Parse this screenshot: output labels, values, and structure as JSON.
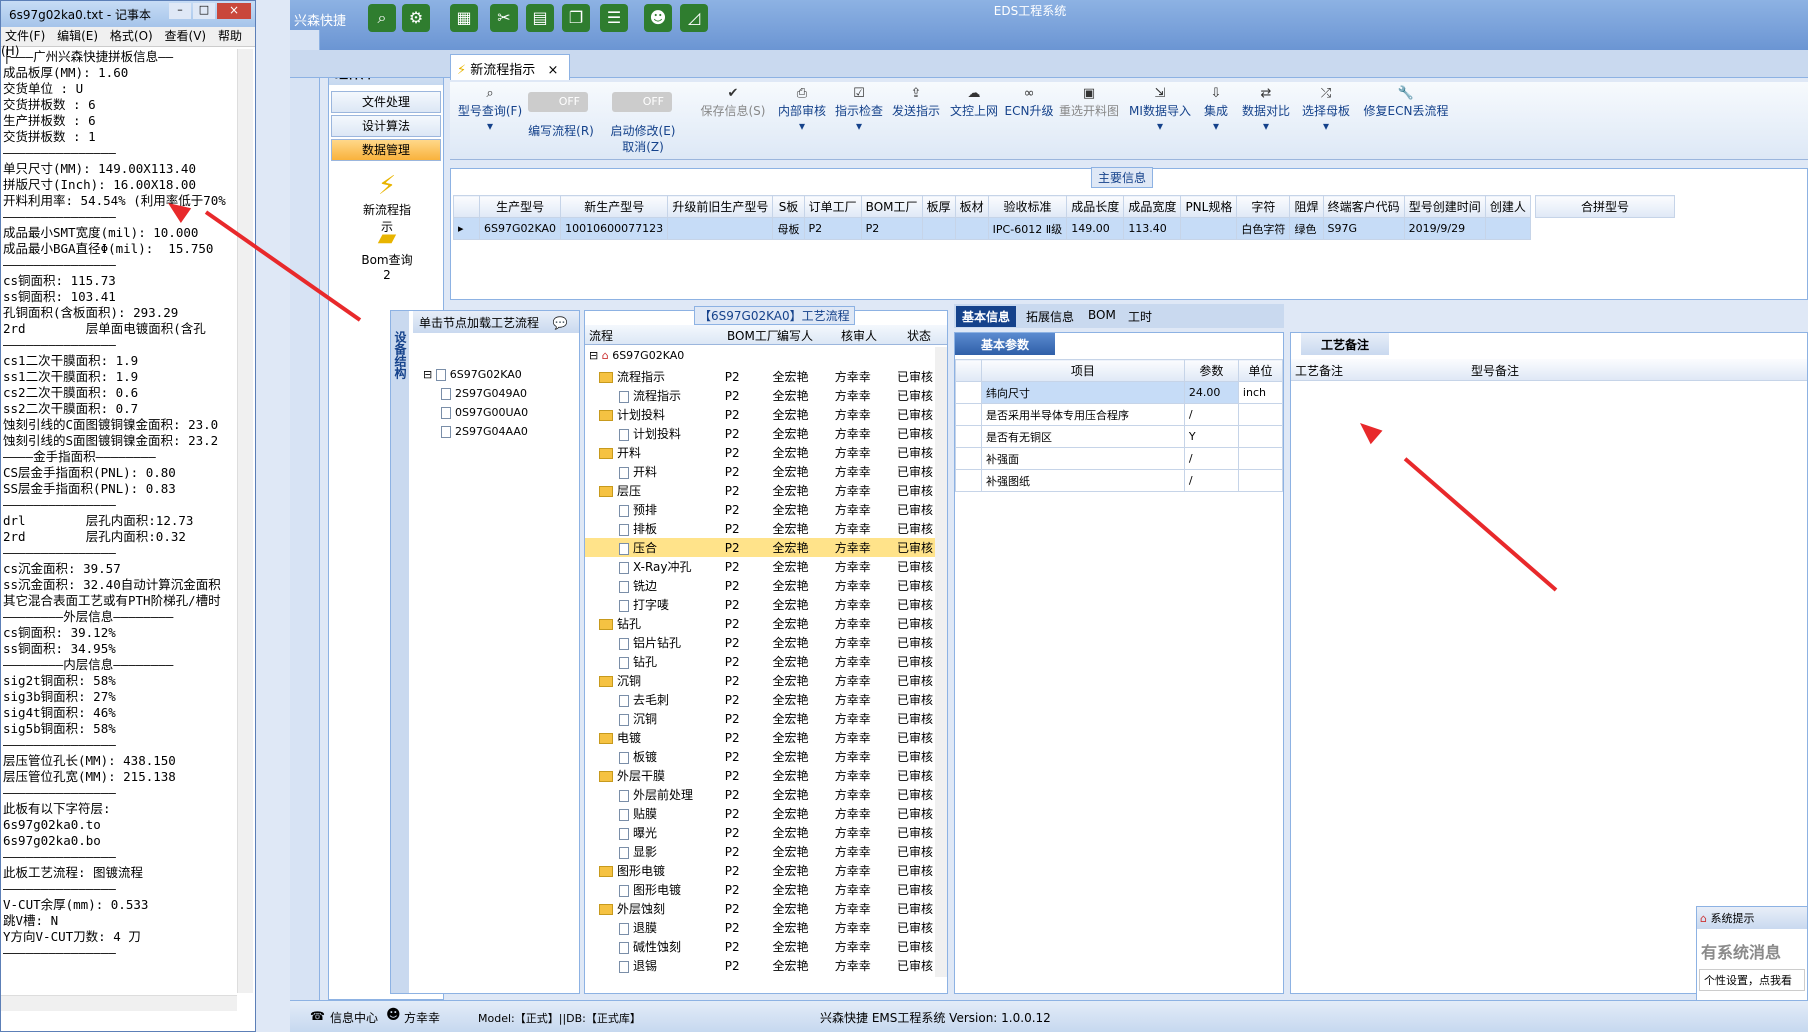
{
  "notepad": {
    "title": "6s97g02ka0.txt - 记事本",
    "menu": [
      "文件(F)",
      "编辑(E)",
      "格式(O)",
      "查看(V)",
      "帮助(H)"
    ],
    "lines": [
      "├———广州兴森快捷拼板信息——",
      "成品板厚(MM): 1.60",
      "交货单位 : U",
      "交货拼板数 : 6",
      "生产拼板数 : 6",
      "交货拼板数 : 1",
      "———————————————",
      "单只尺寸(MM): 149.00X113.40",
      "拼版尺寸(Inch): 16.00X18.00",
      "开料利用率: 54.54% (利用率低于70%",
      "———————————————",
      "成品最小SMT宽度(mil): 10.000",
      "成品最小BGA直径Φ(mil):  15.750",
      "———————————————",
      "cs铜面积: 115.73",
      "ss铜面积: 103.41",
      "孔铜面积(含板面积): 293.29",
      "2rd        层单面电镀面积(含孔",
      "———————————————",
      "cs1二次干膜面积: 1.9",
      "ss1二次干膜面积: 1.9",
      "cs2二次干膜面积: 0.6",
      "ss2二次干膜面积: 0.7",
      "蚀刻引线的C面图镀铜镍金面积: 23.0",
      "蚀刻引线的S面图镀铜镍金面积: 23.2",
      "————金手指面积————————",
      "CS层金手指面积(PNL): 0.80",
      "SS层金手指面积(PNL): 0.83",
      "———————————————",
      "drl        层孔内面积:12.73",
      "2rd        层孔内面积:0.32",
      "———————————————",
      "",
      "cs沉金面积: 39.57",
      "ss沉金面积: 32.40自动计算沉金面积",
      "其它混合表面工艺或有PTH阶梯孔/槽时",
      "————————外层信息————————",
      "cs铜面积: 39.12%",
      "ss铜面积: 34.95%",
      "————————内层信息————————",
      "sig2t铜面积: 58%",
      "sig3b铜面积: 27%",
      "sig4t铜面积: 46%",
      "sig5b铜面积: 58%",
      "———————————————",
      "层压管位孔长(MM): 438.150",
      "层压管位孔宽(MM): 215.138",
      "———————————————",
      "此板有以下字符层:",
      "6s97g02ka0.to",
      "6s97g02ka0.bo",
      "———————————————",
      "此板工艺流程: 图镀流程",
      "———————————————",
      "V-CUT余厚(mm): 0.533",
      "跳V槽: N",
      "Y方向V-CUT刀数: 4 刀",
      "———————————————"
    ]
  },
  "app": {
    "title": "EDS工程系统",
    "brand": "兴森快捷"
  },
  "component_panel": {
    "title": "组件库",
    "buttons": [
      "文件处理",
      "设计算法",
      "数据管理"
    ],
    "items": [
      "新流程指示",
      "Bom查询2"
    ]
  },
  "tab": {
    "label": "新流程指示"
  },
  "ribbon": {
    "buttons": [
      {
        "icon": "search-icon",
        "label": "型号查询(F)"
      },
      {
        "icon": "toggle",
        "label": "编写流程(R)",
        "toggle": "OFF"
      },
      {
        "icon": "toggle",
        "label": "启动修改(E)",
        "toggle": "OFF"
      },
      {
        "icon": "check-icon",
        "label": "保存信息(S)"
      },
      {
        "icon": "print-icon",
        "label": "内部审核"
      },
      {
        "icon": "check-icon",
        "label": "指示检查"
      },
      {
        "icon": "upload-icon",
        "label": "发送指示"
      },
      {
        "icon": "cloud-icon",
        "label": "文控上网"
      },
      {
        "icon": "binoculars-icon",
        "label": "ECN升级"
      },
      {
        "icon": "image-icon",
        "label": "重选开料图"
      },
      {
        "icon": "import-icon",
        "label": "MI数据导入"
      },
      {
        "icon": "download-icon",
        "label": "集成"
      },
      {
        "icon": "compare-icon",
        "label": "数据对比"
      },
      {
        "icon": "shuffle-icon",
        "label": "选择母板"
      },
      {
        "icon": "wrench-icon",
        "label": "修复ECN丢流程"
      }
    ],
    "cancel": "取消(Z)"
  },
  "main_info": {
    "label": "主要信息",
    "columns": [
      "生产型号",
      "新生产型号",
      "升级前旧生产型号",
      "S板",
      "订单工厂",
      "BOM工厂",
      "板厚",
      "板材",
      "验收标准",
      "成品长度",
      "成品宽度",
      "PNL规格",
      "字符",
      "阻焊",
      "终端客户代码",
      "型号创建时间",
      "创建人"
    ],
    "row": [
      "6S97G02KA0",
      "10010600077123",
      "",
      "母板",
      "P2",
      "P2",
      "",
      "",
      "IPC-6012 Ⅱ级",
      "149.00",
      "113.40",
      "",
      "白色字符",
      "绿色",
      "S97G",
      "2019/9/29",
      ""
    ],
    "right_header": "合拼型号"
  },
  "tree_panel": {
    "vtab": "设备结构",
    "head": "单击节点加载工艺流程",
    "root": "6S97G02KA0",
    "children": [
      "2S97G049A0",
      "0S97G00UA0",
      "2S97G04AA0"
    ]
  },
  "flow": {
    "label": "【6S97G02KA0】工艺流程",
    "columns": [
      "流程",
      "BOM工厂",
      "编写人",
      "核审人",
      "状态"
    ],
    "root": "6S97G02KA0",
    "rows": [
      {
        "type": "folder",
        "name": "流程指示"
      },
      {
        "type": "doc",
        "name": "流程指示"
      },
      {
        "type": "folder",
        "name": "计划投料"
      },
      {
        "type": "doc",
        "name": "计划投料"
      },
      {
        "type": "folder",
        "name": "开料"
      },
      {
        "type": "doc",
        "name": "开料"
      },
      {
        "type": "folder",
        "name": "层压"
      },
      {
        "type": "doc",
        "name": "预排"
      },
      {
        "type": "doc",
        "name": "排板"
      },
      {
        "type": "doc",
        "name": "压合",
        "hl": true
      },
      {
        "type": "doc",
        "name": "X-Ray冲孔"
      },
      {
        "type": "doc",
        "name": "铣边"
      },
      {
        "type": "doc",
        "name": "打字唛"
      },
      {
        "type": "folder",
        "name": "钻孔"
      },
      {
        "type": "doc",
        "name": "铝片钻孔"
      },
      {
        "type": "doc",
        "name": "钻孔"
      },
      {
        "type": "folder",
        "name": "沉铜"
      },
      {
        "type": "doc",
        "name": "去毛刺"
      },
      {
        "type": "doc",
        "name": "沉铜"
      },
      {
        "type": "folder",
        "name": "电镀"
      },
      {
        "type": "doc",
        "name": "板镀"
      },
      {
        "type": "folder",
        "name": "外层干膜"
      },
      {
        "type": "doc",
        "name": "外层前处理"
      },
      {
        "type": "doc",
        "name": "贴膜"
      },
      {
        "type": "doc",
        "name": "曝光"
      },
      {
        "type": "doc",
        "name": "显影"
      },
      {
        "type": "folder",
        "name": "图形电镀"
      },
      {
        "type": "doc",
        "name": "图形电镀"
      },
      {
        "type": "folder",
        "name": "外层蚀刻"
      },
      {
        "type": "doc",
        "name": "退膜"
      },
      {
        "type": "doc",
        "name": "碱性蚀刻"
      },
      {
        "type": "doc",
        "name": "退锡"
      }
    ],
    "bom": "P2",
    "writer": "全宏艳",
    "reviewer": "方幸幸",
    "status": "已审核"
  },
  "detail": {
    "tabs": [
      "基本信息",
      "拓展信息",
      "BOM",
      "工时"
    ],
    "section": "基本参数",
    "columns": [
      "项目",
      "参数",
      "单位"
    ],
    "rows": [
      [
        "纬向尺寸",
        "24.00",
        "inch"
      ],
      [
        "是否采用半导体专用压合程序",
        "/",
        ""
      ],
      [
        "是否有无铜区",
        "Y",
        ""
      ],
      [
        "补强面",
        "/",
        ""
      ],
      [
        "补强图纸",
        "/",
        ""
      ]
    ]
  },
  "remark": {
    "title": "工艺备注",
    "columns": [
      "工艺备注",
      "型号备注"
    ]
  },
  "popup": {
    "title": "系统提示",
    "text": "有系统消息",
    "sub": "个性设置，点我看"
  },
  "status": {
    "info": "信息中心",
    "user": "方幸幸",
    "model": "Model:【正式】||DB:【正式库】",
    "version": "兴森快捷 EMS工程系统 Version: 1.0.0.12"
  }
}
